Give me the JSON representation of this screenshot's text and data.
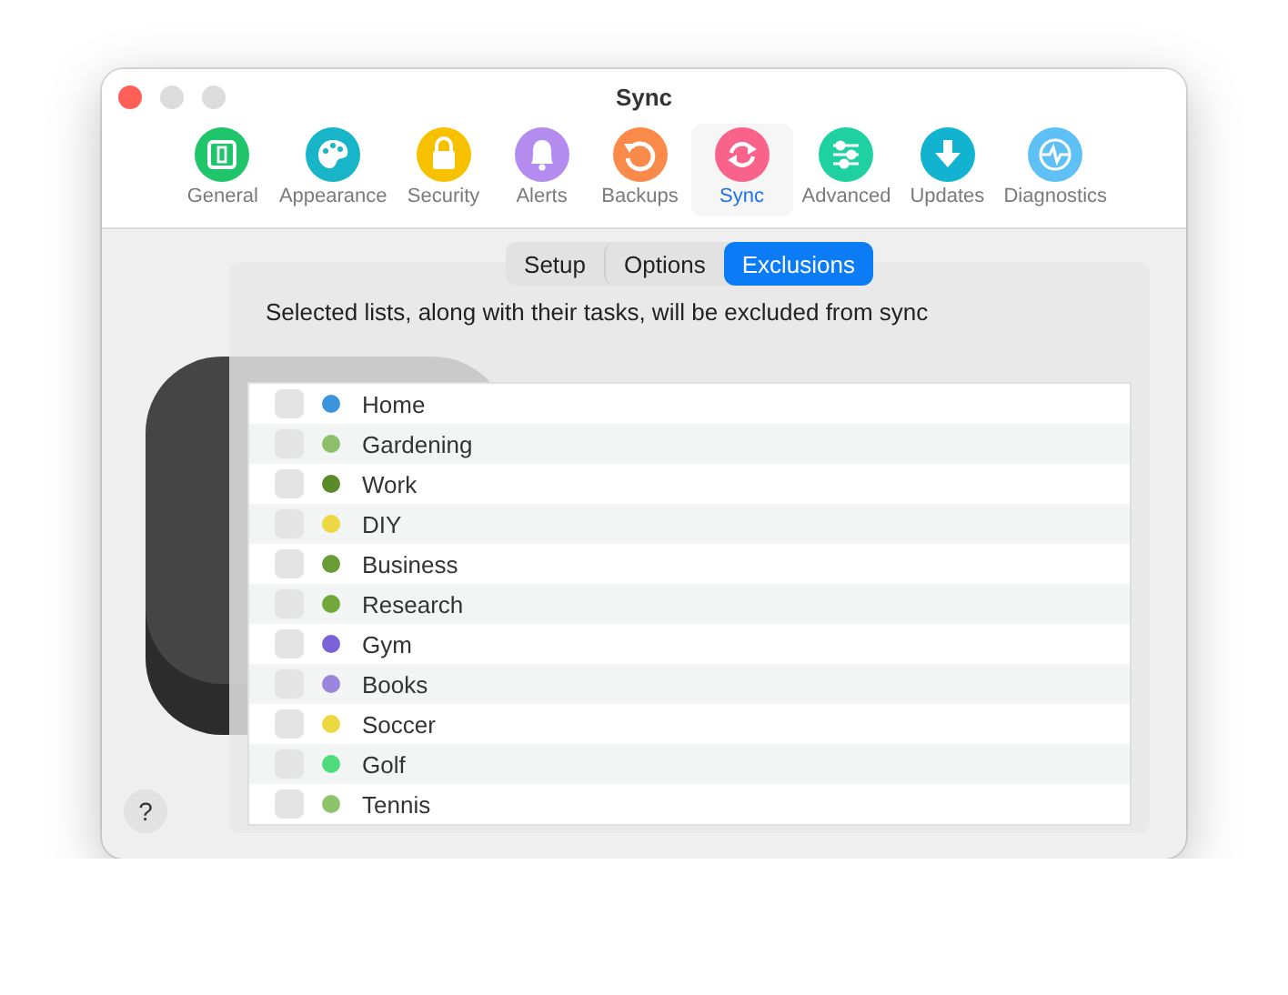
{
  "window": {
    "title": "Sync"
  },
  "toolbar": [
    {
      "label": "General",
      "selected": false,
      "color": "#1fc46b"
    },
    {
      "label": "Appearance",
      "selected": false,
      "color": "#17b5c7"
    },
    {
      "label": "Security",
      "selected": false,
      "color": "#f7c100"
    },
    {
      "label": "Alerts",
      "selected": false,
      "color": "#b48cf0"
    },
    {
      "label": "Backups",
      "selected": false,
      "color": "#fa8a4a"
    },
    {
      "label": "Sync",
      "selected": true,
      "color": "#f9628a"
    },
    {
      "label": "Advanced",
      "selected": false,
      "color": "#1fd1a0"
    },
    {
      "label": "Updates",
      "selected": false,
      "color": "#12b3d0"
    },
    {
      "label": "Diagnostics",
      "selected": false,
      "color": "#5ec0f5"
    }
  ],
  "segments": [
    {
      "label": "Setup",
      "selected": false
    },
    {
      "label": "Options",
      "selected": false
    },
    {
      "label": "Exclusions",
      "selected": true
    }
  ],
  "description": "Selected lists, along with their tasks, will be excluded from sync",
  "lists": [
    {
      "name": "Home",
      "checked": false,
      "color": "#3b94dc"
    },
    {
      "name": "Gardening",
      "checked": false,
      "color": "#8dbf6a"
    },
    {
      "name": "Work",
      "checked": false,
      "color": "#5a8a2a"
    },
    {
      "name": "DIY",
      "checked": false,
      "color": "#ecd840"
    },
    {
      "name": "Business",
      "checked": false,
      "color": "#6a9c36"
    },
    {
      "name": "Research",
      "checked": false,
      "color": "#72a83a"
    },
    {
      "name": "Gym",
      "checked": false,
      "color": "#7b62d6"
    },
    {
      "name": "Books",
      "checked": false,
      "color": "#9a84dc"
    },
    {
      "name": "Soccer",
      "checked": false,
      "color": "#ecd840"
    },
    {
      "name": "Golf",
      "checked": false,
      "color": "#4fdb7c"
    },
    {
      "name": "Tennis",
      "checked": false,
      "color": "#8dc46a"
    }
  ],
  "help": {
    "label": "?"
  }
}
